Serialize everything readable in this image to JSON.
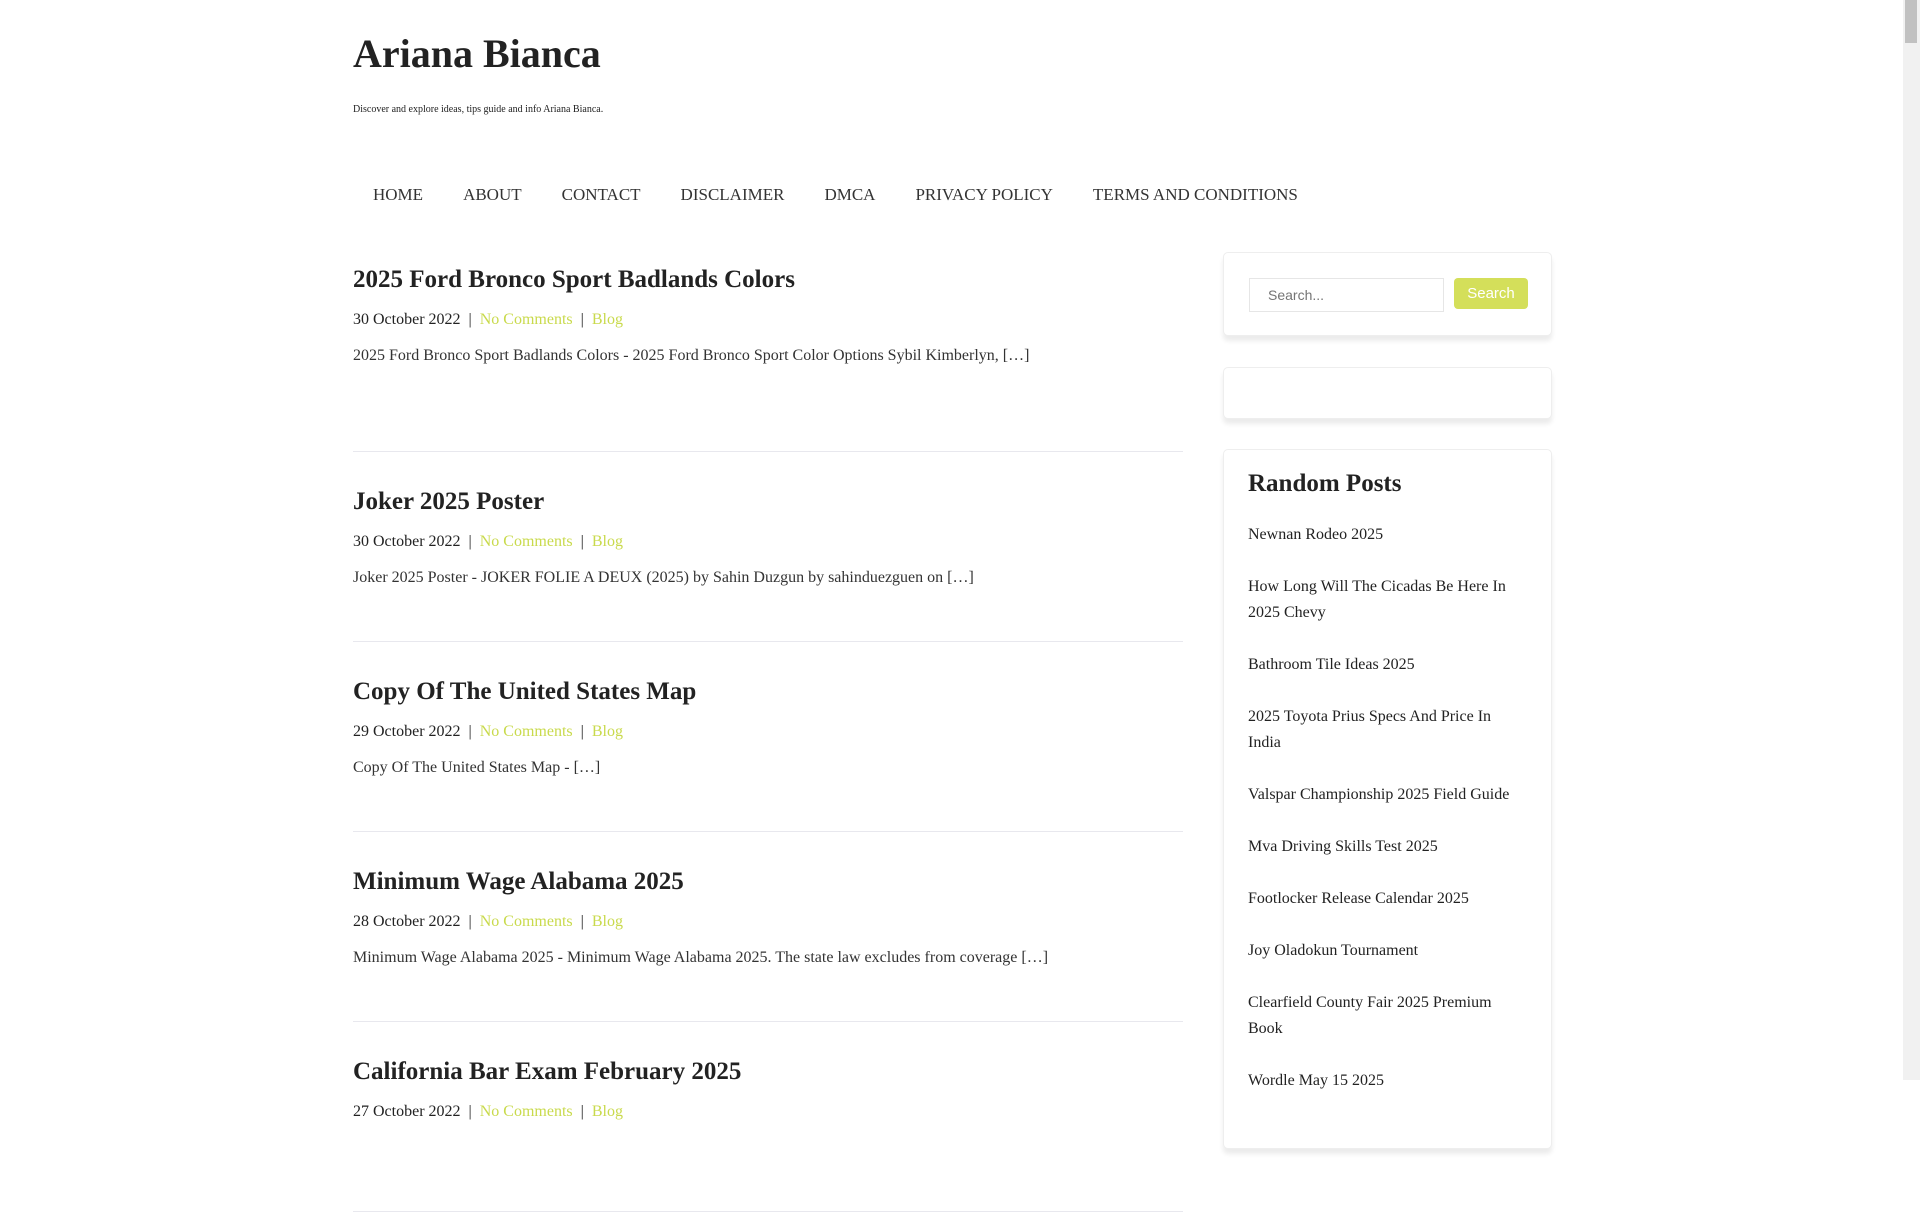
{
  "site": {
    "title": "Ariana Bianca",
    "tagline": "Discover and explore ideas, tips guide and info Ariana Bianca."
  },
  "nav": [
    "HOME",
    "ABOUT",
    "CONTACT",
    "DISCLAIMER",
    "DMCA",
    "PRIVACY POLICY",
    "TERMS AND CONDITIONS"
  ],
  "posts": [
    {
      "title": "2025 Ford Bronco Sport Badlands Colors",
      "date": "30 October 2022",
      "comments": "No Comments",
      "category": "Blog",
      "excerpt": "2025 Ford Bronco Sport Badlands Colors - 2025 Ford Bronco Sport Color Options Sybil Kimberlyn, […]"
    },
    {
      "title": "Joker 2025 Poster",
      "date": "30 October 2022",
      "comments": "No Comments",
      "category": "Blog",
      "excerpt": "Joker 2025 Poster - JOKER FOLIE A DEUX (2025) by Sahin Duzgun by sahinduezguen on […]"
    },
    {
      "title": "Copy Of The United States Map",
      "date": "29 October 2022",
      "comments": "No Comments",
      "category": "Blog",
      "excerpt": "Copy Of The United States Map - […]"
    },
    {
      "title": "Minimum Wage Alabama 2025",
      "date": "28 October 2022",
      "comments": "No Comments",
      "category": "Blog",
      "excerpt": "Minimum Wage Alabama 2025 - Minimum Wage Alabama 2025. The state law excludes from coverage […]"
    },
    {
      "title": "California Bar Exam February 2025",
      "date": "27 October 2022",
      "comments": "No Comments",
      "category": "Blog",
      "excerpt": ""
    }
  ],
  "meta_separator": "|",
  "search": {
    "placeholder": "Search...",
    "button": "Search"
  },
  "random": {
    "title": "Random Posts",
    "items": [
      "Newnan Rodeo 2025",
      "How Long Will The Cicadas Be Here In 2025 Chevy",
      "Bathroom Tile Ideas 2025",
      "2025 Toyota Prius Specs And Price In India",
      "Valspar Championship 2025 Field Guide",
      "Mva Driving Skills Test 2025",
      "Footlocker Release Calendar 2025",
      "Joy Oladokun Tournament",
      "Clearfield County Fair 2025 Premium Book",
      "Wordle May 15 2025"
    ]
  },
  "colors": {
    "accent": "#d4df5a",
    "link": "#c9da4c"
  }
}
